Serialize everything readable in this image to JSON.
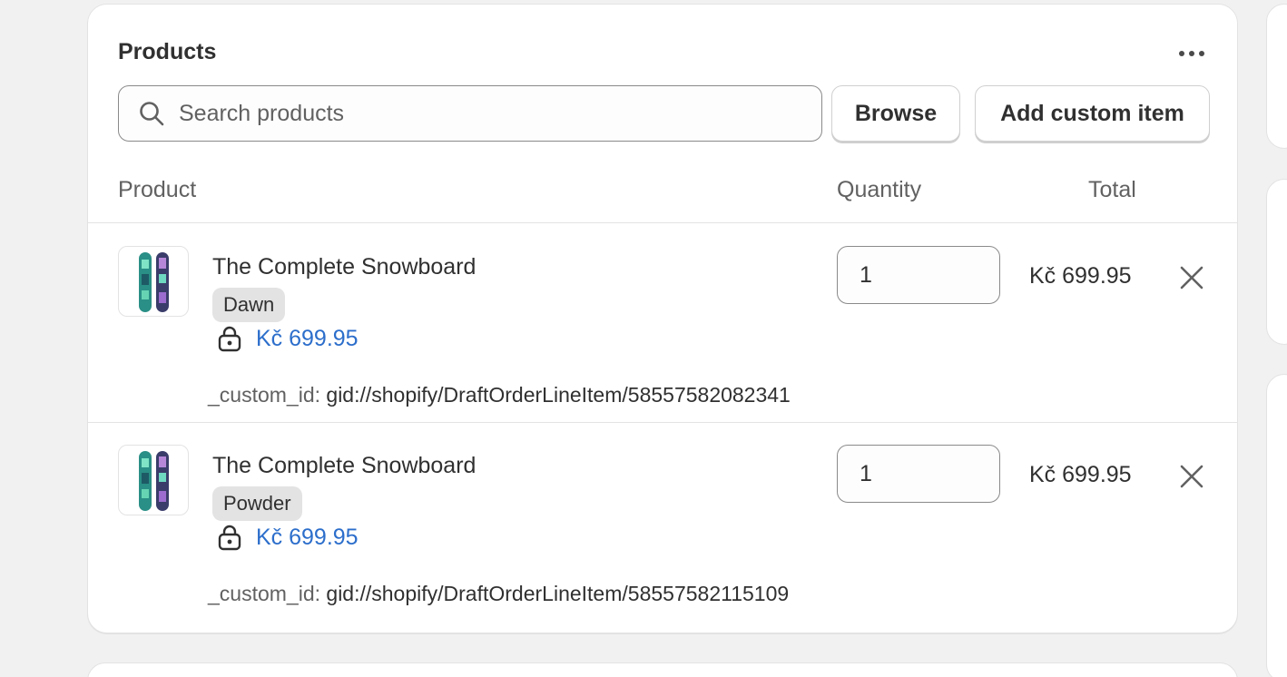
{
  "card": {
    "title": "Products"
  },
  "search": {
    "placeholder": "Search products"
  },
  "buttons": {
    "browse": "Browse",
    "add_custom_item": "Add custom item"
  },
  "columns": {
    "product": "Product",
    "quantity": "Quantity",
    "total": "Total"
  },
  "line_items": [
    {
      "name": "The Complete Snowboard",
      "variant": "Dawn",
      "unit_price": "Kč 699.95",
      "quantity": "1",
      "total": "Kč 699.95",
      "custom_id_key": "_custom_id:",
      "custom_id_value": "gid://shopify/DraftOrderLineItem/58557582082341"
    },
    {
      "name": "The Complete Snowboard",
      "variant": "Powder",
      "unit_price": "Kč 699.95",
      "quantity": "1",
      "total": "Kč 699.95",
      "custom_id_key": "_custom_id:",
      "custom_id_value": "gid://shopify/DraftOrderLineItem/58557582115109"
    }
  ],
  "icons": {
    "search": "search-icon",
    "more": "more-horizontal-icon",
    "lock": "lock-icon",
    "remove": "close-icon",
    "thumbnail": "snowboard-thumbnail"
  },
  "colors": {
    "link": "#2c6ecb",
    "background": "#f1f1f1",
    "card": "#ffffff",
    "badge": "#e3e3e3"
  }
}
